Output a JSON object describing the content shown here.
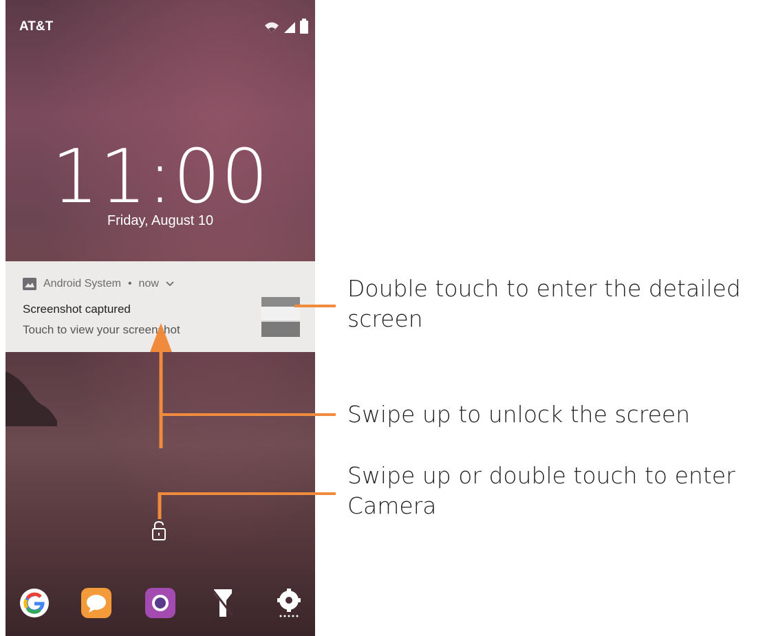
{
  "status_bar": {
    "carrier": "AT&T",
    "icons": [
      "wifi-signal-icon",
      "cell-signal-icon",
      "battery-icon"
    ]
  },
  "lockscreen": {
    "time": "11:00",
    "date": "Friday, August 10"
  },
  "notification": {
    "app_name": "Android System",
    "separator": "•",
    "time": "now",
    "title": "Screenshot captured",
    "text": "Touch to view your screenshot",
    "icon": "image-icon",
    "thumbnail_icon": "screenshot-thumbnail"
  },
  "lock": {
    "icon": "padlock-icon"
  },
  "dock": {
    "icons": [
      "google-icon",
      "messages-icon",
      "camera-icon",
      "flashlight-icon",
      "settings-icon"
    ]
  },
  "annotations": [
    {
      "text": "Double touch to enter the detailed screen",
      "line1": "Double touch to enter the detailed",
      "line2": "screen"
    },
    {
      "text": "Swipe up to unlock the screen"
    },
    {
      "text": "Swipe up or double touch to enter Camera",
      "line1": "Swipe up or double touch to enter",
      "line2": "Camera"
    }
  ],
  "colors": {
    "accent": "#f08a3c",
    "notification_bg": "#ecebea"
  }
}
